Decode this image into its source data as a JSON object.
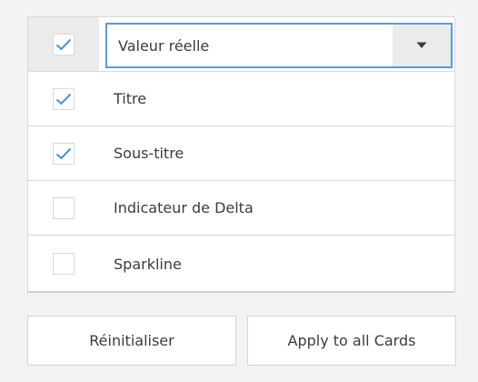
{
  "fields": {
    "header": {
      "checked": true,
      "selected_value": "Valeur réelle"
    },
    "items": [
      {
        "label": "Titre",
        "checked": true
      },
      {
        "label": "Sous-titre",
        "checked": true
      },
      {
        "label": "Indicateur de Delta",
        "checked": false
      },
      {
        "label": "Sparkline",
        "checked": false
      }
    ]
  },
  "buttons": {
    "reset_label": "Réinitialiser",
    "apply_label": "Apply to all Cards"
  },
  "colors": {
    "accent": "#5b9bd5",
    "check": "#4a90d9"
  },
  "icons": {
    "check": "checkmark-icon",
    "dropdown": "caret-down-icon"
  }
}
